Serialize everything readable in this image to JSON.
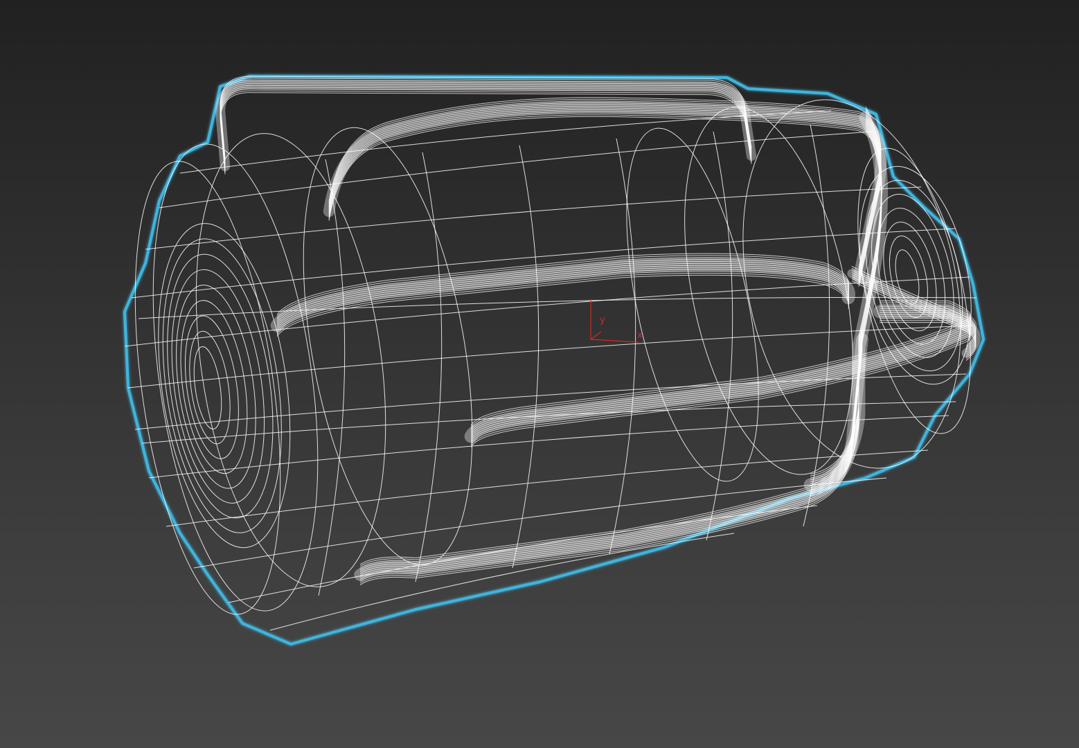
{
  "viewport": {
    "background_top": "#212121",
    "background_bottom": "#474747",
    "wire_color": "#ffffff",
    "selection_outline_color": "#3fb4dc"
  },
  "gizmo": {
    "x_label": "x",
    "y_label": "y",
    "axis_color": "#d22a2a"
  }
}
